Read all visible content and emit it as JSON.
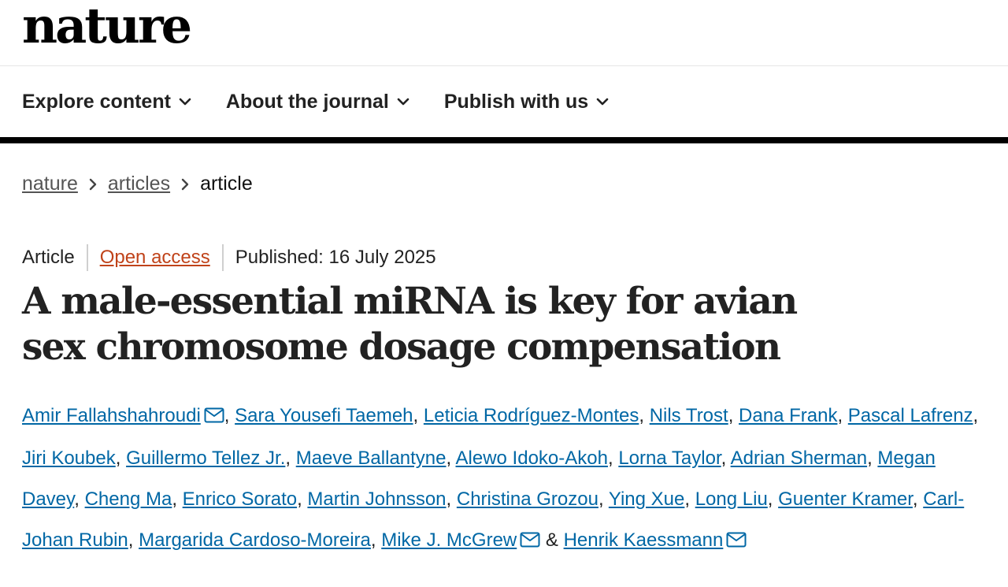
{
  "header": {
    "logo": "nature"
  },
  "nav": {
    "items": [
      {
        "label": "Explore content",
        "icon": "chevron-down-icon"
      },
      {
        "label": "About the journal",
        "icon": "chevron-down-icon"
      },
      {
        "label": "Publish with us",
        "icon": "chevron-down-icon"
      }
    ]
  },
  "breadcrumb": {
    "items": [
      "nature",
      "articles"
    ],
    "current": "article"
  },
  "article": {
    "type": "Article",
    "access": "Open access",
    "published": "Published: 16 July 2025",
    "title": "A male-essential miRNA is key for avian sex chromosome dosage compensation",
    "authors": [
      {
        "name": "Amir Fallahshahroudi",
        "mail": true
      },
      {
        "name": "Sara Yousefi Taemeh",
        "mail": false
      },
      {
        "name": "Leticia Rodríguez-Montes",
        "mail": false
      },
      {
        "name": "Nils Trost",
        "mail": false
      },
      {
        "name": "Dana Frank",
        "mail": false
      },
      {
        "name": "Pascal Lafrenz",
        "mail": false
      },
      {
        "name": "Jiri Koubek",
        "mail": false
      },
      {
        "name": "Guillermo Tellez Jr.",
        "mail": false
      },
      {
        "name": "Maeve Ballantyne",
        "mail": false
      },
      {
        "name": "Alewo Idoko-Akoh",
        "mail": false
      },
      {
        "name": "Lorna Taylor",
        "mail": false
      },
      {
        "name": "Adrian Sherman",
        "mail": false
      },
      {
        "name": "Megan Davey",
        "mail": false
      },
      {
        "name": "Cheng Ma",
        "mail": false
      },
      {
        "name": "Enrico Sorato",
        "mail": false
      },
      {
        "name": "Martin Johnsson",
        "mail": false
      },
      {
        "name": "Christina Grozou",
        "mail": false
      },
      {
        "name": "Ying Xue",
        "mail": false
      },
      {
        "name": "Long Liu",
        "mail": false
      },
      {
        "name": "Guenter Kramer",
        "mail": false
      },
      {
        "name": "Carl-Johan Rubin",
        "mail": false
      },
      {
        "name": "Margarida Cardoso-Moreira",
        "mail": false
      },
      {
        "name": "Mike J. McGrew",
        "mail": true
      },
      {
        "name": "Henrik Kaessmann",
        "mail": true
      }
    ]
  },
  "colors": {
    "link": "#0067a5",
    "open_access": "#c0431a",
    "rule": "#000000"
  }
}
